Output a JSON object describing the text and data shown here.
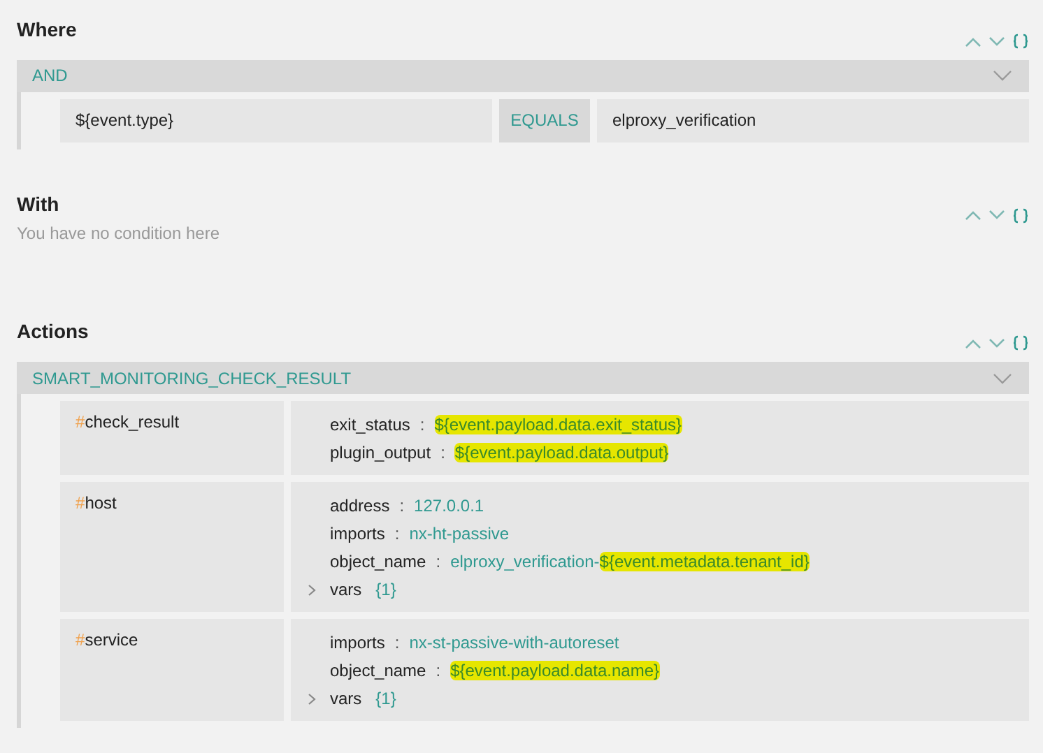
{
  "where": {
    "title": "Where",
    "group": {
      "label": "AND",
      "expanded": true
    },
    "conditions": [
      {
        "field": "${event.type}",
        "operator": "EQUALS",
        "value": "elproxy_verification"
      }
    ]
  },
  "with": {
    "title": "With",
    "empty_text": "You have no condition here"
  },
  "actions": {
    "title": "Actions",
    "group": {
      "label": "SMART_MONITORING_CHECK_RESULT",
      "expanded": true
    },
    "items": [
      {
        "prefix": "#",
        "name": "check_result",
        "fields": [
          {
            "kind": "field",
            "key": "exit_status",
            "separator": ":",
            "parts": [
              {
                "text": "${event.payload.data.exit_status}",
                "highlighted": true
              }
            ]
          },
          {
            "kind": "field",
            "key": "plugin_output",
            "separator": ":",
            "parts": [
              {
                "text": "${event.payload.data.output}",
                "highlighted": true
              }
            ]
          }
        ]
      },
      {
        "prefix": "#",
        "name": "host",
        "fields": [
          {
            "kind": "field",
            "key": "address",
            "separator": ":",
            "parts": [
              {
                "text": "127.0.0.1",
                "highlighted": false
              }
            ]
          },
          {
            "kind": "field",
            "key": "imports",
            "separator": ":",
            "parts": [
              {
                "text": "nx-ht-passive",
                "highlighted": false
              }
            ]
          },
          {
            "kind": "field",
            "key": "object_name",
            "separator": ":",
            "parts": [
              {
                "text": "elproxy_verification-",
                "highlighted": false
              },
              {
                "text": "${event.metadata.tenant_id}",
                "highlighted": true
              }
            ]
          },
          {
            "kind": "group",
            "key": "vars",
            "count": "{1}",
            "expanded": false
          }
        ]
      },
      {
        "prefix": "#",
        "name": "service",
        "fields": [
          {
            "kind": "field",
            "key": "imports",
            "separator": ":",
            "parts": [
              {
                "text": "nx-st-passive-with-autoreset",
                "highlighted": false
              }
            ]
          },
          {
            "kind": "field",
            "key": "object_name",
            "separator": ":",
            "parts": [
              {
                "text": "${event.payload.data.name}",
                "highlighted": true
              }
            ]
          },
          {
            "kind": "group",
            "key": "vars",
            "count": "{1}",
            "expanded": false
          }
        ]
      }
    ]
  }
}
